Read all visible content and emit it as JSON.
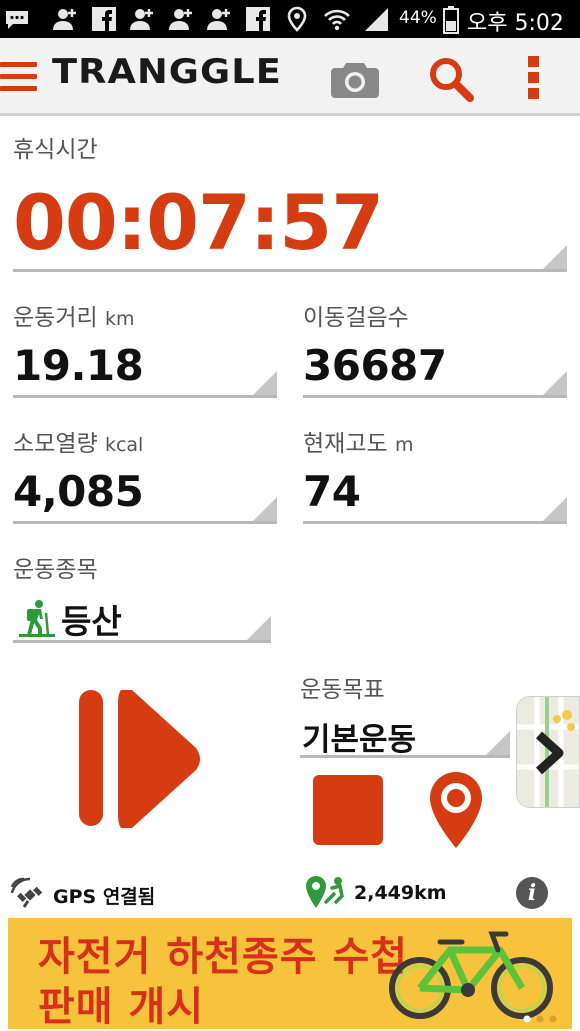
{
  "status_bar": {
    "battery_percent": "44%",
    "time": "오후 5:02"
  },
  "app_bar": {
    "logo": "TRANGGLE",
    "icons": [
      "menu-icon",
      "camera-icon",
      "search-icon",
      "more-vert-icon"
    ]
  },
  "rest_time": {
    "label": "휴식시간",
    "value": "00:07:57"
  },
  "distance": {
    "label": "운동거리",
    "unit": "km",
    "value": "19.18"
  },
  "steps": {
    "label": "이동걸음수",
    "value": "36687"
  },
  "calories": {
    "label": "소모열량",
    "unit": "kcal",
    "value": "4,085"
  },
  "altitude": {
    "label": "현재고도",
    "unit": "m",
    "value": "74"
  },
  "activity_type": {
    "label": "운동종목",
    "value": "등산"
  },
  "goal": {
    "label": "운동목표",
    "value": "기본운동"
  },
  "footer": {
    "gps_status": "GPS 연결됨",
    "total_distance": "2,449km"
  },
  "banner": {
    "line1": "자전거 하천종주 수첩",
    "line2": "판매 개시"
  },
  "colors": {
    "accent": "#d63c12",
    "banner_bg": "#f7c23c",
    "banner_text": "#d6301a",
    "hiker_green": "#2e9a3a"
  }
}
